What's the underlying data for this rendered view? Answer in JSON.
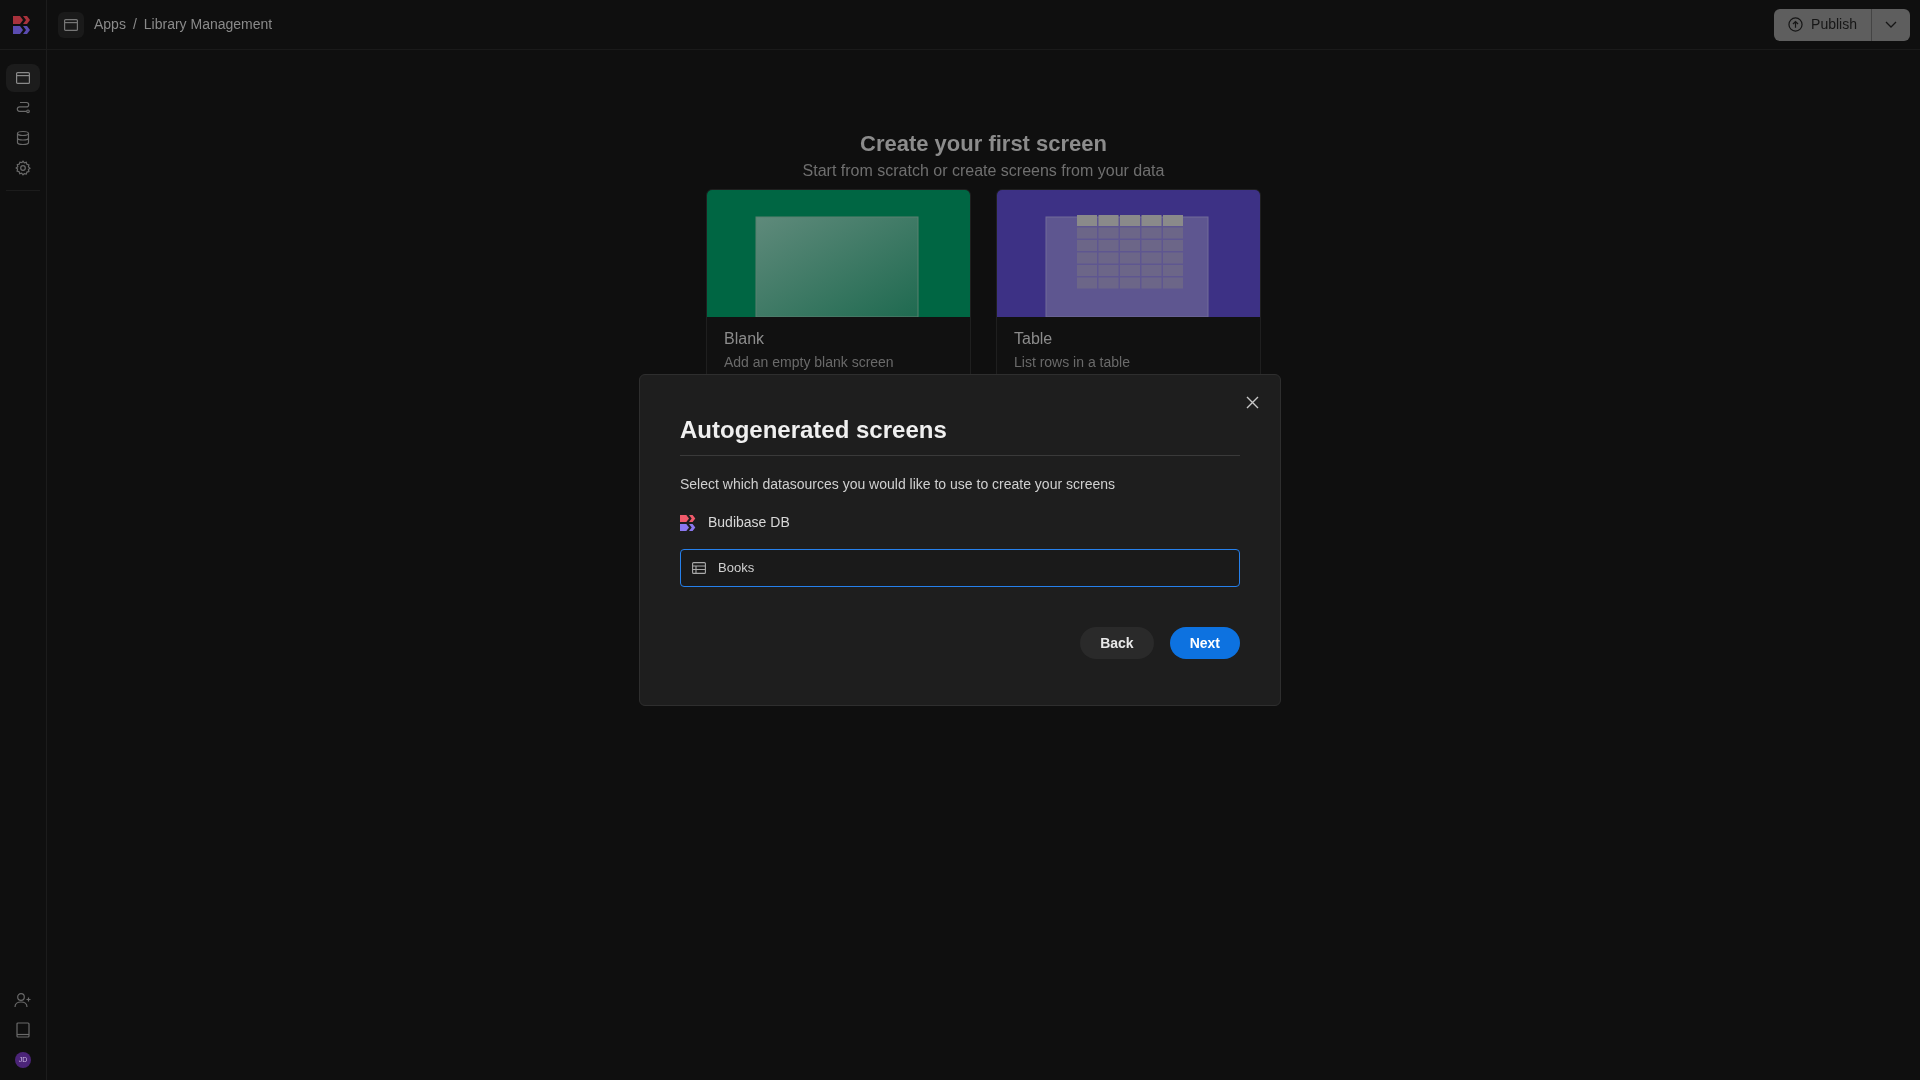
{
  "sidebar": {
    "nav": [
      {
        "kind": "screens",
        "selected": true
      },
      {
        "kind": "automations",
        "selected": false
      },
      {
        "kind": "data",
        "selected": false
      },
      {
        "kind": "settings",
        "selected": false
      }
    ],
    "bottom": [
      {
        "kind": "invite"
      },
      {
        "kind": "docs"
      },
      {
        "kind": "avatar",
        "initials": "JD"
      }
    ]
  },
  "breadcrumb": [
    "Apps",
    "/",
    "Library Management"
  ],
  "publish": {
    "label": "Publish"
  },
  "heading": {
    "title": "Create your first screen",
    "subtitle": "Start from scratch or create screens from your data"
  },
  "cards": [
    {
      "kind": "blank",
      "color": "#006643",
      "title": "Blank",
      "description": "Add an empty blank screen"
    },
    {
      "kind": "table",
      "color": "#3d3185",
      "title": "Table",
      "description": "List rows in a table"
    }
  ],
  "modal": {
    "title": "Autogenerated screens",
    "description": "Select which datasources you would like to use to create your screens",
    "datasources": [
      {
        "name": "Budibase DB",
        "tables": [
          {
            "name": "Books",
            "selected": true
          }
        ]
      }
    ],
    "buttons": [
      {
        "kind": "secondary",
        "label": "Back"
      },
      {
        "kind": "primary",
        "label": "Next"
      }
    ]
  }
}
